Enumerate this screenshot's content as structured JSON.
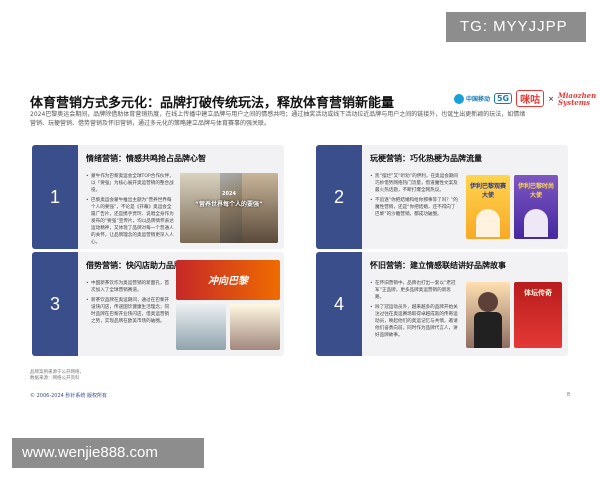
{
  "watermark_top": "TG: MYYJJPP",
  "watermark_bottom": "www.wenjie888.com",
  "title": "体育营销方式多元化：品牌打破传统玩法，释放体育营销新能量",
  "logos": {
    "china_mobile": "中国移动",
    "fiveg": "5G",
    "migu": "咪咕",
    "x": "×",
    "miaozhen": "Miaozhen Systems"
  },
  "intro": "2024巴黎奥运会期间，品牌除借助体育营销热度，在线上传播中建立品牌与用户之间的情感共鸣；通过抽奖活动或线下活动拉近品牌与用户之间的链接外，也诞生出更新颖的玩法，如情绪营销、玩梗营销、借势营销及怀旧营销，通过多元化的策略建立品牌与体育赛事的强关联。",
  "cards": [
    {
      "num": "1",
      "title": "情绪营销：情感共鸣抢占品牌心智",
      "bullets": [
        "蒙牛作为巴黎奥运会全球TOP合作伙伴，以「要强」为核心展开奥运营销的整合战役。",
        "巴黎奥运会蒙牛推出主题为“营养世界每个人的要强”，不论是《开幕》奥运会全篇广告片，还是携手贾玲、说唱全身作为发布的“要强”宣传片，均以品牌情怀表达运动精神，又体现了品牌对每一个普通人的关怀，让品牌理念的奥运营销更深入人心。"
      ],
      "photo_text": "“营养世界每个人的要强”",
      "photo_year": "2024"
    },
    {
      "num": "2",
      "title": "玩梗营销：巧化热梗为品牌流量",
      "bullets": [
        "凯“摆烂”又“听劝”的伊利，在奥运会期间巧妙借势网络热门流量，借道魔性文案及最火热话题，不断打爆全网热议。",
        "不追逐“你把结婚和给你那事等了吗？”的魔性营销，还是“你把结婚，还不得向了巴黎”的沙雕营销，都成功破圈。"
      ],
      "photo_text": "伊利巴黎观赛大使",
      "photo_text2": "伊利巴黎时尚大使"
    },
    {
      "num": "3",
      "title": "借势营销：快闪店助力品牌出海",
      "bullets": [
        "中国新茶饮作为奥运营销的新面孔，首次加入了全球营销赛道。",
        "新茶饮品牌在奥运期间，通过在巴黎开设快闪店，传递国饮健康生活理念；同时品牌在巴黎开业快闪店，借奥运营销之势，实现品牌在欧美市场的破圈。"
      ],
      "photo_text": "冲向巴黎"
    },
    {
      "num": "4",
      "title": "怀旧营销：建立情感联结讲好品牌故事",
      "bullets": [
        "在怀旧营销中，品牌也打出一套以“老冠军”正品牌，更多品牌奥运营销的新思路。",
        "除了冠运动员外，越来越多的品牌开始关注过往在奥运赛场取得卓越成就的传奇运动员，唤起他们的奥运记忆与共情，邀请他们奋勇向前，同时作为品牌代言人，讲好品牌故事。"
      ],
      "photo_text": "体坛传奇"
    }
  ],
  "footnote": [
    "品牌案例来源于公开网络，",
    "数据来源：网络公开资料"
  ],
  "copyright": "© 2006-2024 秒针系统 版权所有",
  "page_number": "8"
}
